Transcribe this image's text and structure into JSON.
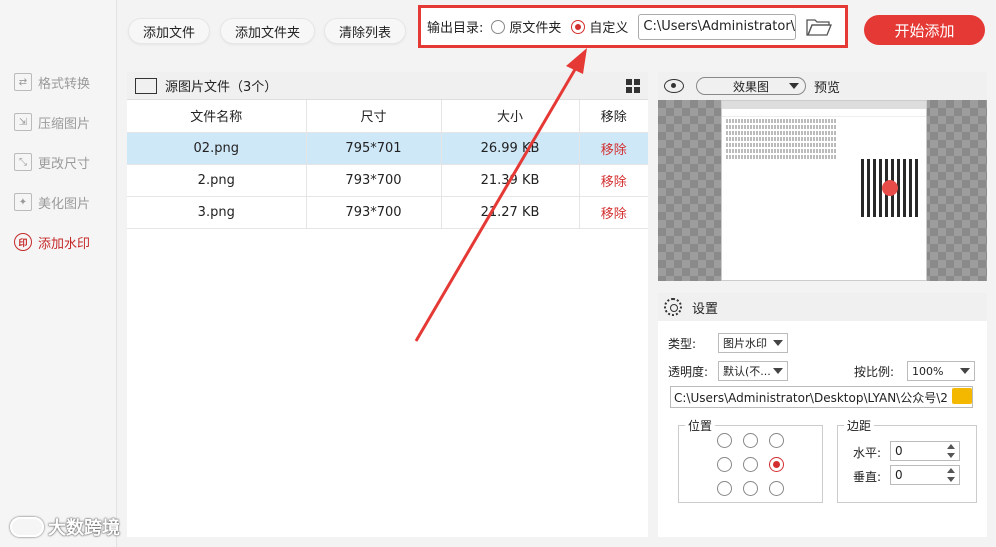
{
  "sidebar": {
    "items": [
      {
        "label": "格式转换",
        "icon": "convert-icon",
        "active": false
      },
      {
        "label": "压缩图片",
        "icon": "compress-icon",
        "active": false
      },
      {
        "label": "更改尺寸",
        "icon": "resize-icon",
        "active": false
      },
      {
        "label": "美化图片",
        "icon": "beautify-icon",
        "active": false
      },
      {
        "label": "添加水印",
        "icon": "watermark-stamp-icon",
        "icon_text": "印",
        "active": true
      }
    ]
  },
  "toolbar": {
    "add_file": "添加文件",
    "add_folder": "添加文件夹",
    "clear_list": "清除列表",
    "output_label": "输出目录:",
    "opt_original": "原文件夹",
    "opt_custom": "自定义",
    "output_path": "C:\\Users\\Administrator\\I",
    "start": "开始添加"
  },
  "file_panel": {
    "title": "源图片文件（3个）",
    "columns": [
      "文件名称",
      "尺寸",
      "大小",
      "移除"
    ],
    "rows": [
      {
        "name": "02.png",
        "size": "795*701",
        "bytes": "26.99 KB",
        "remove": "移除",
        "selected": true
      },
      {
        "name": "2.png",
        "size": "793*700",
        "bytes": "21.39 KB",
        "remove": "移除",
        "selected": false
      },
      {
        "name": "3.png",
        "size": "793*700",
        "bytes": "21.27 KB",
        "remove": "移除",
        "selected": false
      }
    ]
  },
  "preview": {
    "mode": "效果图",
    "label": "预览"
  },
  "settings": {
    "title": "设置",
    "type_label": "类型:",
    "type_value": "图片水印",
    "opacity_label": "透明度:",
    "opacity_value": "默认(不...",
    "scale_label": "按比例:",
    "scale_value": "100%",
    "wm_path": "C:\\Users\\Administrator\\Desktop\\LYAN\\公众号\\2",
    "position_label": "位置",
    "margin_label": "边距",
    "horizontal_label": "水平:",
    "horizontal_value": "0",
    "vertical_label": "垂直:",
    "vertical_value": "0",
    "selected_position": "middle-right"
  },
  "watermark_overlay": "大数跨境",
  "colors": {
    "accent": "#e53935",
    "selected_row": "#cfe8f8",
    "folder_yellow": "#f5b800"
  }
}
